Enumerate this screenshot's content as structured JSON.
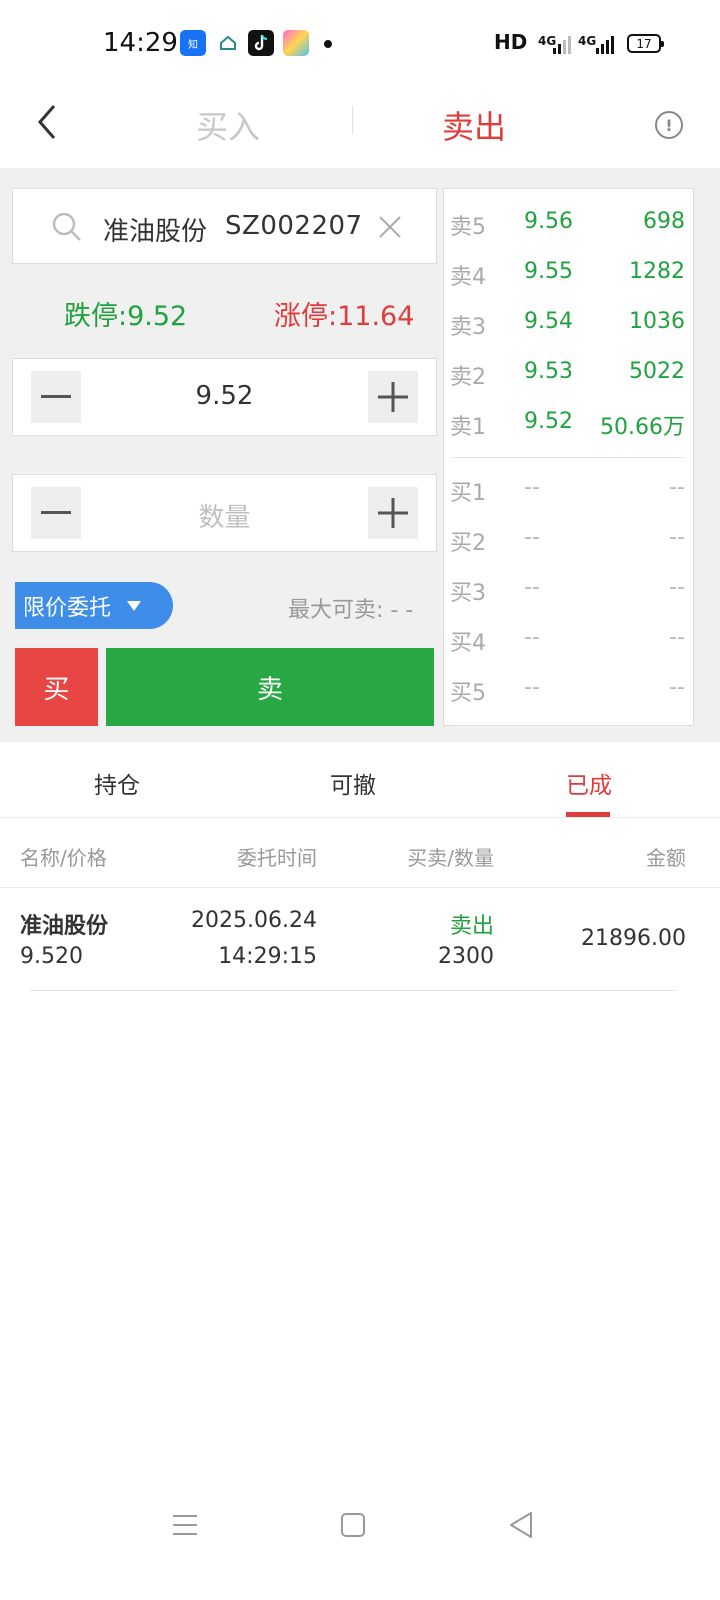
{
  "status_bar": {
    "time": "14:29",
    "network": "HD",
    "signal1": "4G",
    "signal2": "4G",
    "battery": "17",
    "app_icons": [
      "zhihu-icon",
      "smarthome-icon",
      "tiktok-icon",
      "gallery-icon"
    ]
  },
  "header": {
    "buy_tab": "买入",
    "sell_tab": "卖出",
    "active_tab": "sell"
  },
  "stock": {
    "name": "准油股份",
    "code": "SZ002207",
    "limit_down_label": "跌停:9.52",
    "limit_up_label": "涨停:11.64"
  },
  "price_input": {
    "value": "9.52"
  },
  "quantity_input": {
    "placeholder": "数量"
  },
  "order_type": {
    "label": "限价委托"
  },
  "max_sell": {
    "label": "最大可卖: - -"
  },
  "actions": {
    "buy": "买",
    "sell": "卖"
  },
  "order_book": {
    "asks": [
      {
        "label": "卖5",
        "price": "9.56",
        "volume": "698"
      },
      {
        "label": "卖4",
        "price": "9.55",
        "volume": "1282"
      },
      {
        "label": "卖3",
        "price": "9.54",
        "volume": "1036"
      },
      {
        "label": "卖2",
        "price": "9.53",
        "volume": "5022"
      },
      {
        "label": "卖1",
        "price": "9.52",
        "volume": "50.66万"
      }
    ],
    "bids": [
      {
        "label": "买1",
        "price": "--",
        "volume": "--"
      },
      {
        "label": "买2",
        "price": "--",
        "volume": "--"
      },
      {
        "label": "买3",
        "price": "--",
        "volume": "--"
      },
      {
        "label": "买4",
        "price": "--",
        "volume": "--"
      },
      {
        "label": "买5",
        "price": "--",
        "volume": "--"
      }
    ]
  },
  "list_tabs": [
    {
      "label": "持仓"
    },
    {
      "label": "可撤"
    },
    {
      "label": "已成"
    }
  ],
  "active_list_tab": 2,
  "table": {
    "headers": [
      "名称/价格",
      "委托时间",
      "买卖/数量",
      "金额"
    ],
    "rows": [
      {
        "name": "准油股份",
        "price": "9.520",
        "date": "2025.06.24",
        "time": "14:29:15",
        "side": "卖出",
        "quantity": "2300",
        "amount": "21896.00"
      }
    ]
  },
  "colors": {
    "sell_red": "#e03c3c",
    "buy_green": "#22a13f",
    "accent_blue": "#3e8ee9"
  }
}
